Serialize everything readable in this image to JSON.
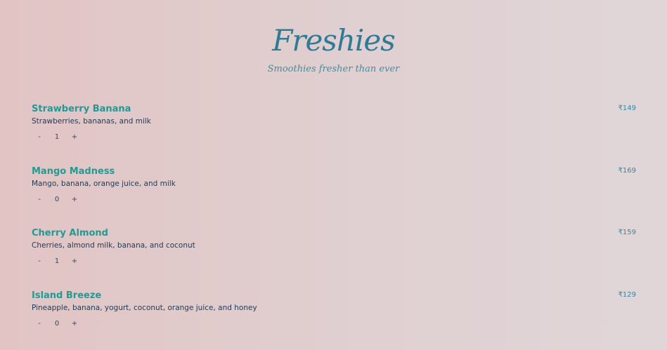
{
  "header": {
    "brand": "Freshies",
    "tagline": "Smoothies fresher than ever"
  },
  "menu": {
    "items": [
      {
        "name": "Strawberry Banana",
        "description": "Strawberries, bananas, and milk",
        "price": "₹149",
        "quantity": "1",
        "decrement_label": "-",
        "increment_label": "+"
      },
      {
        "name": "Mango Madness",
        "description": "Mango, banana, orange juice, and milk",
        "price": "₹169",
        "quantity": "0",
        "decrement_label": "-",
        "increment_label": "+"
      },
      {
        "name": "Cherry Almond",
        "description": "Cherries, almond milk, banana, and coconut",
        "price": "₹159",
        "quantity": "1",
        "decrement_label": "-",
        "increment_label": "+"
      },
      {
        "name": "Island Breeze",
        "description": "Pineapple, banana, yogurt, coconut, orange juice, and honey",
        "price": "₹129",
        "quantity": "0",
        "decrement_label": "-",
        "increment_label": "+"
      }
    ]
  }
}
